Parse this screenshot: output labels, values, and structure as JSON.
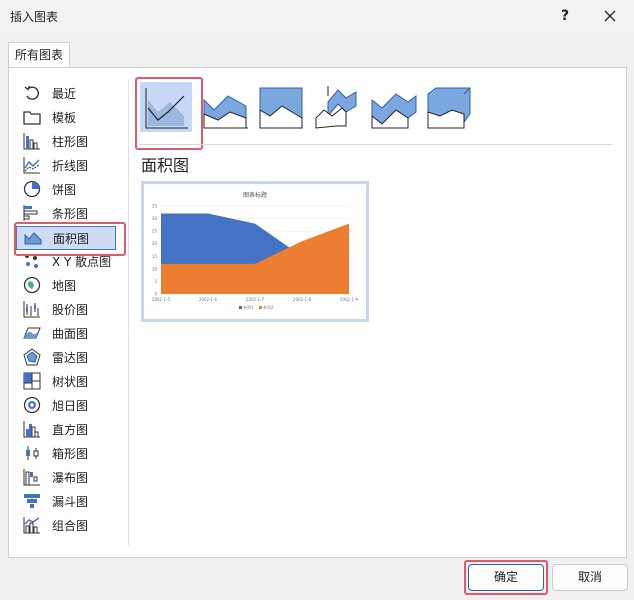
{
  "dialog": {
    "title": "插入图表",
    "help_glyph": "?"
  },
  "tabs": [
    {
      "label": "所有图表"
    }
  ],
  "categories": [
    {
      "label": "最近",
      "icon": "recent-icon"
    },
    {
      "label": "模板",
      "icon": "folder-icon"
    },
    {
      "label": "柱形图",
      "icon": "column-chart-icon"
    },
    {
      "label": "折线图",
      "icon": "line-chart-icon"
    },
    {
      "label": "饼图",
      "icon": "pie-chart-icon"
    },
    {
      "label": "条形图",
      "icon": "bar-chart-icon"
    },
    {
      "label": "面积图",
      "icon": "area-chart-icon",
      "selected": true
    },
    {
      "label": "X Y 散点图",
      "icon": "scatter-chart-icon"
    },
    {
      "label": "地图",
      "icon": "map-chart-icon"
    },
    {
      "label": "股价图",
      "icon": "stock-chart-icon"
    },
    {
      "label": "曲面图",
      "icon": "surface-chart-icon"
    },
    {
      "label": "雷达图",
      "icon": "radar-chart-icon"
    },
    {
      "label": "树状图",
      "icon": "treemap-chart-icon"
    },
    {
      "label": "旭日图",
      "icon": "sunburst-chart-icon"
    },
    {
      "label": "直方图",
      "icon": "histogram-chart-icon"
    },
    {
      "label": "箱形图",
      "icon": "box-whisker-chart-icon"
    },
    {
      "label": "瀑布图",
      "icon": "waterfall-chart-icon"
    },
    {
      "label": "漏斗图",
      "icon": "funnel-chart-icon"
    },
    {
      "label": "组合图",
      "icon": "combo-chart-icon"
    }
  ],
  "subtypes": [
    {
      "icon": "area-subtype-icon",
      "selected": true
    },
    {
      "icon": "stacked-area-subtype-icon"
    },
    {
      "icon": "percent-stacked-area-subtype-icon"
    },
    {
      "icon": "3d-area-subtype-icon"
    },
    {
      "icon": "3d-stacked-area-subtype-icon"
    },
    {
      "icon": "3d-percent-stacked-area-subtype-icon"
    }
  ],
  "section": {
    "title": "面积图"
  },
  "colors": {
    "series1": "#4472c4",
    "series2": "#ed7d31",
    "accent": "#4a78c2",
    "highlight": "#e05a6b"
  },
  "chart_data": {
    "type": "area",
    "title": "图表标题",
    "x": [
      "2002-1-5",
      "2002-1-6",
      "2002-1-7",
      "2002-1-8",
      "2002-1-9"
    ],
    "ylim": [
      0,
      35
    ],
    "yticks": [
      0,
      5,
      10,
      15,
      20,
      25,
      30,
      35
    ],
    "series": [
      {
        "name": "系列1",
        "values": [
          32,
          32,
          28,
          15,
          15
        ]
      },
      {
        "name": "系列2",
        "values": [
          12,
          12,
          12,
          21,
          28
        ]
      }
    ],
    "legend": "bottom"
  },
  "buttons": {
    "ok": "确定",
    "cancel": "取消"
  }
}
